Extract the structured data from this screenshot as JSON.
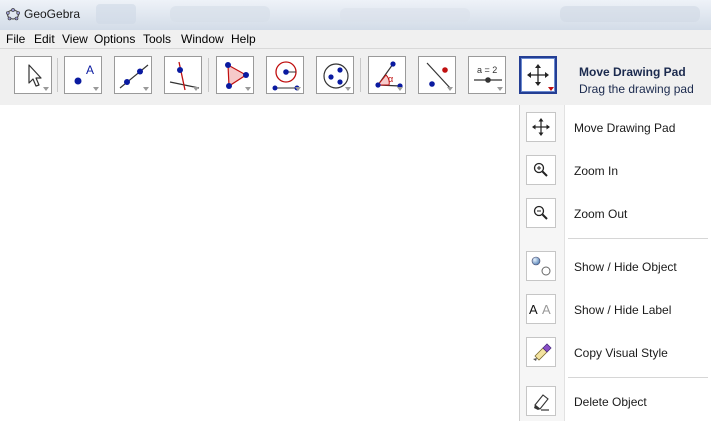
{
  "window": {
    "title": "GeoGebra"
  },
  "menu": {
    "items": [
      "File",
      "Edit",
      "View",
      "Options",
      "Tools",
      "Window",
      "Help"
    ]
  },
  "toolbar": {
    "tools": [
      {
        "icon": "pointer-arrow-icon"
      },
      {
        "icon": "new-point-icon"
      },
      {
        "icon": "line-through-two-points-icon"
      },
      {
        "icon": "perpendicular-line-icon"
      },
      {
        "icon": "polygon-icon"
      },
      {
        "icon": "circle-with-center-icon"
      },
      {
        "icon": "conic-through-points-icon"
      },
      {
        "icon": "angle-icon"
      },
      {
        "icon": "reflect-about-line-icon"
      },
      {
        "icon": "slider-icon",
        "text": "a = 2"
      },
      {
        "icon": "move-drawing-pad-icon",
        "active": true
      }
    ],
    "selected_title": "Move Drawing Pad",
    "selected_help": "Drag the drawing pad"
  },
  "dropdown": {
    "items": [
      {
        "label": "Move Drawing Pad",
        "icon": "move-drawing-pad-icon"
      },
      {
        "label": "Zoom In",
        "icon": "zoom-in-icon"
      },
      {
        "label": "Zoom Out",
        "icon": "zoom-out-icon"
      },
      {
        "label": "Show / Hide Object",
        "icon": "show-hide-object-icon"
      },
      {
        "label": "Show / Hide Label",
        "icon": "show-hide-label-icon",
        "icon_text": "A A"
      },
      {
        "label": "Copy Visual Style",
        "icon": "copy-visual-style-icon"
      },
      {
        "label": "Delete Object",
        "icon": "eraser-icon"
      }
    ]
  },
  "colors": {
    "point_blue": "#0a1aa0",
    "active_border": "#243e94",
    "accent_red": "#c01010"
  }
}
